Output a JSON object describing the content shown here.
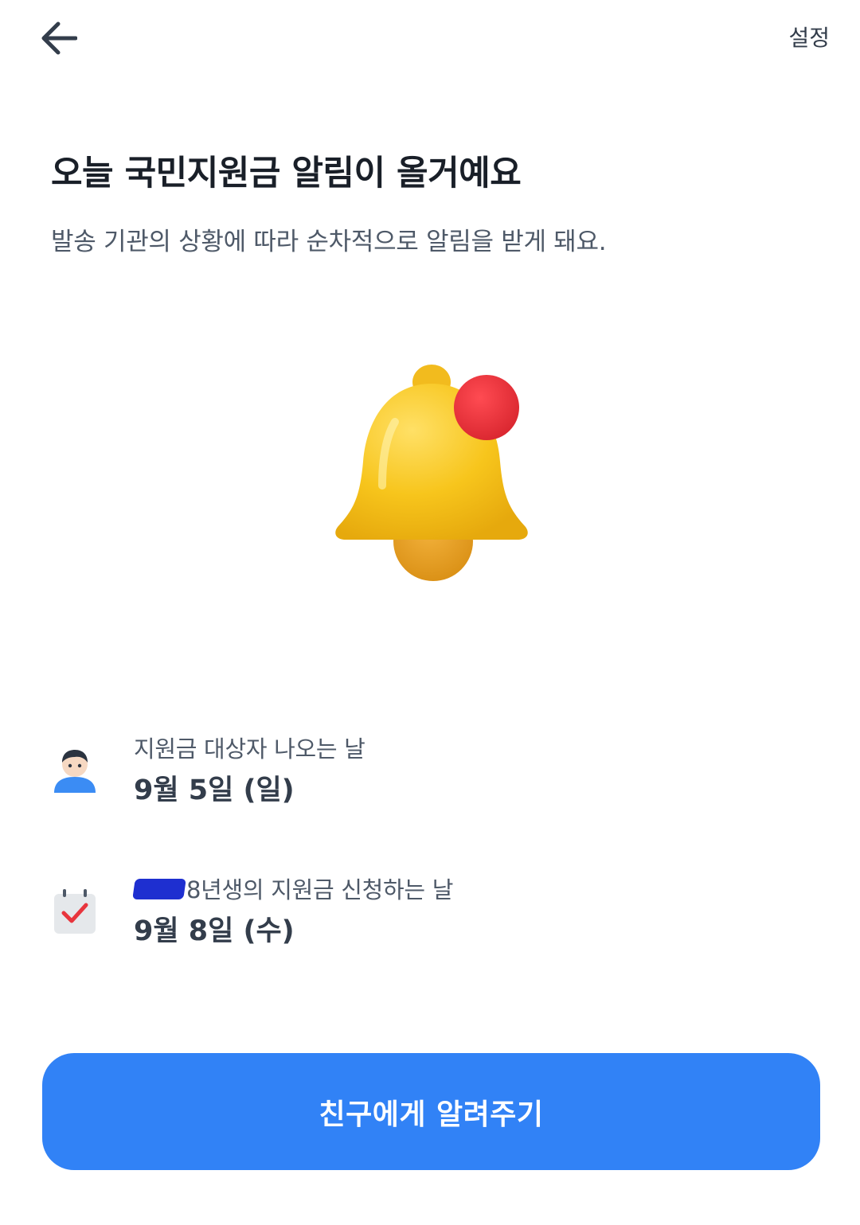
{
  "header": {
    "back_icon": "arrow-left-icon",
    "settings_label": "설정"
  },
  "main": {
    "title": "오늘 국민지원금 알림이 올거예요",
    "subtitle": "발송 기관의 상황에 따라 순차적으로 알림을 받게 돼요.",
    "illustration": "bell-with-notification-dot-icon"
  },
  "schedule": [
    {
      "icon": "person-icon",
      "label": "지원금 대상자 나오는 날",
      "date": "9월 5일 (일)"
    },
    {
      "icon": "calendar-check-icon",
      "label_visible": "8년생의 지원금 신청하는 날",
      "date": "9월 8일 (수)"
    }
  ],
  "footer": {
    "share_button_label": "친구에게 알려주기"
  },
  "colors": {
    "primary": "#3182f6",
    "notification_red": "#e8353d",
    "bell_yellow": "#f5c518",
    "text_primary": "#191f28",
    "text_secondary": "#4e5968"
  }
}
